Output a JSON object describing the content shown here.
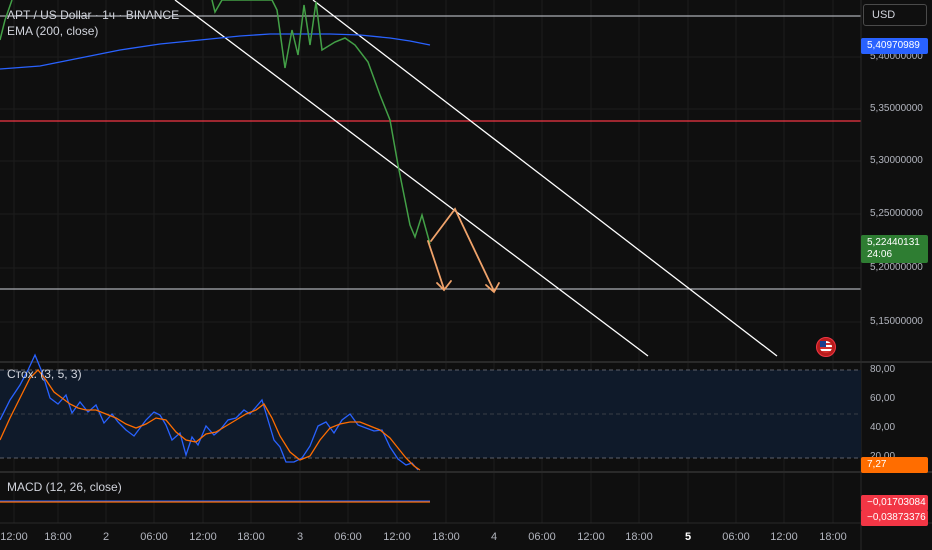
{
  "legend": {
    "symbol": "APT / US Dollar · 1ч · BINANCE",
    "ema": "EMA (200, close)",
    "stoch": "Стох. (3, 5, 3)",
    "macd": "MACD (12, 26, close)"
  },
  "currency": "USD",
  "price_axis": {
    "ticks": [
      "5,40000000",
      "5,35000000",
      "5,30000000",
      "5,25000000",
      "5,20000000",
      "5,15000000"
    ],
    "ema_tag": "5,40970989",
    "price_tag": "5,22440131",
    "countdown": "24:06"
  },
  "stoch_axis": {
    "ticks": [
      "80,00",
      "60,00",
      "40,00",
      "20,00"
    ],
    "value_tag": "7,27"
  },
  "macd_axis": {
    "tag1": "−0,01703084",
    "tag2": "−0,03873376"
  },
  "time_axis": {
    "labels": [
      "12:00",
      "18:00",
      "2",
      "06:00",
      "12:00",
      "18:00",
      "3",
      "06:00",
      "12:00",
      "18:00",
      "4",
      "06:00",
      "12:00",
      "18:00",
      "5",
      "06:00",
      "12:00",
      "18:00"
    ],
    "bold_label": "5"
  },
  "colors": {
    "background": "#0f0f0f",
    "price_line": "#43a047",
    "ema_line": "#2962ff",
    "resistance_red": "#f23645",
    "stoch_k": "#2962ff",
    "stoch_d": "#ff6d00",
    "arrow": "#f0a36b",
    "ema_tag_bg": "#2962ff",
    "price_tag_bg": "#2e7d32",
    "stoch_tag_bg": "#ff6d00",
    "macd_tag_bg": "#f23645"
  },
  "icons": [
    "us-flag-icon"
  ]
}
